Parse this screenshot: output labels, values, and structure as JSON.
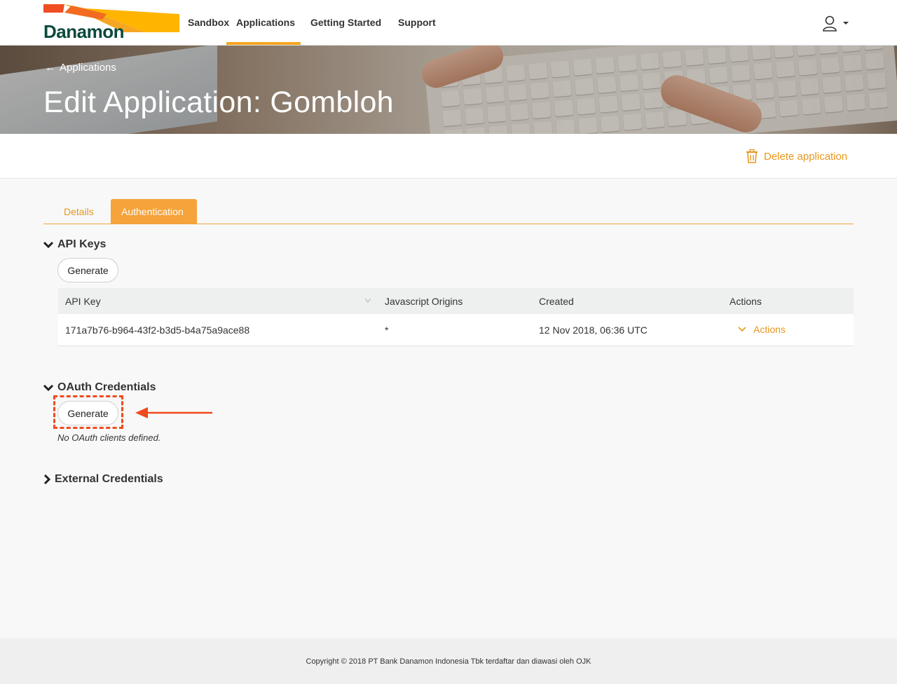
{
  "header": {
    "brand": "Danamon",
    "nav": [
      {
        "label": "Sandbox"
      },
      {
        "label": "Applications"
      },
      {
        "label": "Getting Started"
      },
      {
        "label": "Support"
      }
    ],
    "active_nav": "Applications",
    "user_icon": "user-icon",
    "accent_color": "#f5a623"
  },
  "hero": {
    "breadcrumb": "Applications",
    "title": "Edit Application: Gombloh"
  },
  "actions": {
    "delete_label": "Delete application",
    "delete_icon": "trash-icon"
  },
  "tabs": [
    {
      "label": "Details",
      "active": false
    },
    {
      "label": "Authentication",
      "active": true
    }
  ],
  "api_keys": {
    "title": "API Keys",
    "generate_label": "Generate",
    "columns": [
      "API Key",
      "Javascript Origins",
      "Created",
      "Actions"
    ],
    "rows": [
      {
        "key": "171a7b76-b964-43f2-b3d5-b4a75a9ace88",
        "origins": "*",
        "created": "12 Nov 2018, 06:36 UTC",
        "actions": "Actions"
      }
    ]
  },
  "oauth": {
    "title": "OAuth Credentials",
    "generate_label": "Generate",
    "empty_text": "No OAuth clients defined."
  },
  "external": {
    "title": "External Credentials"
  },
  "footer": {
    "text": "Copyright © 2018 PT Bank Danamon Indonesia Tbk terdaftar dan diawasi oleh OJK"
  }
}
